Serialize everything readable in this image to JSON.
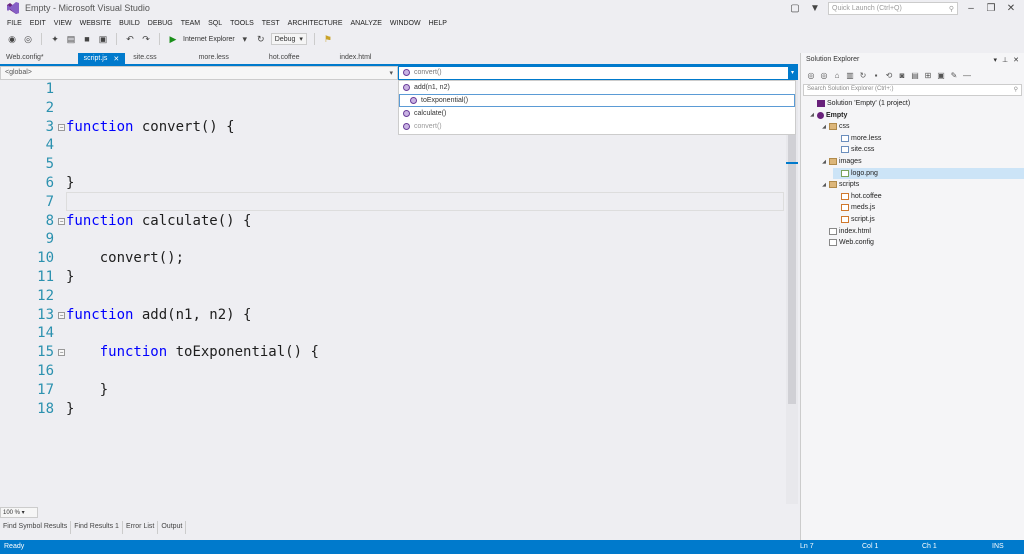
{
  "window": {
    "title": "Empty - Microsoft Visual Studio",
    "quick_launch_placeholder": "Quick Launch (Ctrl+Q)"
  },
  "menu": [
    "FILE",
    "EDIT",
    "VIEW",
    "WEBSITE",
    "BUILD",
    "DEBUG",
    "TEAM",
    "SQL",
    "TOOLS",
    "TEST",
    "ARCHITECTURE",
    "ANALYZE",
    "WINDOW",
    "HELP"
  ],
  "toolbar": {
    "browser": "Internet Explorer",
    "config": "Debug"
  },
  "tabs": [
    {
      "label": "Web.config*",
      "active": false
    },
    {
      "label": "script.js",
      "active": true
    },
    {
      "label": "site.css",
      "active": false
    },
    {
      "label": "more.less",
      "active": false
    },
    {
      "label": "hot.coffee",
      "active": false
    },
    {
      "label": "index.html",
      "active": false
    }
  ],
  "navbar": {
    "scope": "<global>",
    "member": "convert()"
  },
  "member_dropdown": [
    {
      "label": "add(n1, n2)",
      "child": false,
      "selected": false,
      "dim": false
    },
    {
      "label": "toExponential()",
      "child": true,
      "selected": true,
      "dim": false
    },
    {
      "label": "calculate()",
      "child": false,
      "selected": false,
      "dim": false
    },
    {
      "label": "convert()",
      "child": false,
      "selected": false,
      "dim": true
    }
  ],
  "code_lines": [
    {
      "n": "1",
      "kw": "",
      "text": "",
      "fold": ""
    },
    {
      "n": "2",
      "kw": "",
      "text": "",
      "fold": ""
    },
    {
      "n": "3",
      "kw": "function",
      "text": " convert() {",
      "fold": "−"
    },
    {
      "n": "4",
      "kw": "",
      "text": "",
      "fold": ""
    },
    {
      "n": "5",
      "kw": "",
      "text": "",
      "fold": ""
    },
    {
      "n": "6",
      "kw": "",
      "text": "}",
      "fold": ""
    },
    {
      "n": "7",
      "kw": "",
      "text": "",
      "fold": ""
    },
    {
      "n": "8",
      "kw": "function",
      "text": " calculate() {",
      "fold": "−"
    },
    {
      "n": "9",
      "kw": "",
      "text": "",
      "fold": ""
    },
    {
      "n": "10",
      "kw": "",
      "text": "    convert();",
      "fold": ""
    },
    {
      "n": "11",
      "kw": "",
      "text": "}",
      "fold": ""
    },
    {
      "n": "12",
      "kw": "",
      "text": "",
      "fold": ""
    },
    {
      "n": "13",
      "kw": "function",
      "text": " add(n1, n2) {",
      "fold": "−"
    },
    {
      "n": "14",
      "kw": "",
      "text": "",
      "fold": ""
    },
    {
      "n": "15",
      "kw": "    function",
      "text": " toExponential() {",
      "fold": "−"
    },
    {
      "n": "16",
      "kw": "",
      "text": "",
      "fold": ""
    },
    {
      "n": "17",
      "kw": "",
      "text": "    }",
      "fold": ""
    },
    {
      "n": "18",
      "kw": "",
      "text": "}",
      "fold": ""
    }
  ],
  "zoom": "100 %",
  "bottom_tabs": [
    "Find Symbol Results",
    "Find Results 1",
    "Error List",
    "Output"
  ],
  "status": {
    "state": "Ready",
    "ln": "Ln 7",
    "col": "Col 1",
    "ch": "Ch 1",
    "mode": "INS"
  },
  "solution_explorer": {
    "title": "Solution Explorer",
    "search_placeholder": "Search Solution Explorer (Ctrl+;)",
    "tree": [
      {
        "label": "Solution 'Empty' (1 project)",
        "depth": 0,
        "icon": "sol",
        "tri": "",
        "selected": false
      },
      {
        "label": "Empty",
        "depth": 0,
        "icon": "proj",
        "tri": "◢",
        "selected": false,
        "bold": true
      },
      {
        "label": "css",
        "depth": 1,
        "icon": "folder",
        "tri": "◢",
        "selected": false
      },
      {
        "label": "more.less",
        "depth": 2,
        "icon": "file-css",
        "tri": "",
        "selected": false
      },
      {
        "label": "site.css",
        "depth": 2,
        "icon": "file-css",
        "tri": "",
        "selected": false
      },
      {
        "label": "images",
        "depth": 1,
        "icon": "folder",
        "tri": "◢",
        "selected": false
      },
      {
        "label": "logo.png",
        "depth": 2,
        "icon": "file-img",
        "tri": "",
        "selected": true
      },
      {
        "label": "scripts",
        "depth": 1,
        "icon": "folder",
        "tri": "◢",
        "selected": false
      },
      {
        "label": "hot.coffee",
        "depth": 2,
        "icon": "file-js",
        "tri": "",
        "selected": false
      },
      {
        "label": "meds.js",
        "depth": 2,
        "icon": "file-js",
        "tri": "",
        "selected": false
      },
      {
        "label": "script.js",
        "depth": 2,
        "icon": "file-js",
        "tri": "",
        "selected": false
      },
      {
        "label": "index.html",
        "depth": 1,
        "icon": "file-html",
        "tri": "",
        "selected": false
      },
      {
        "label": "Web.config",
        "depth": 1,
        "icon": "file-html",
        "tri": "",
        "selected": false
      }
    ]
  }
}
